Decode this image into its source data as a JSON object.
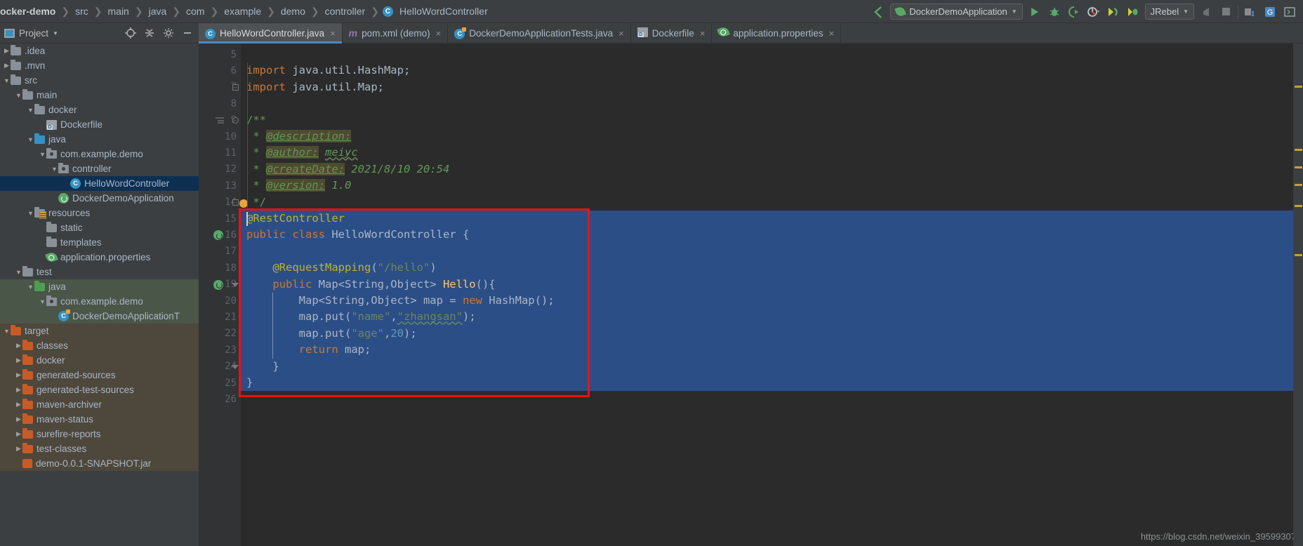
{
  "breadcrumb": {
    "items": [
      "ocker-demo",
      "src",
      "main",
      "java",
      "com",
      "example",
      "demo",
      "controller"
    ],
    "current": "HelloWordController",
    "current_icon": "C"
  },
  "toolbar": {
    "back_icon": "back-arrow-icon",
    "run_config_label": "DockerDemoApplication",
    "run_label": "run-icon",
    "debug_label": "debug-icon",
    "run_coverage_label": "run-with-coverage-icon",
    "profiler_label": "profiler-icon",
    "jrebel_run_label": "jrebel-run-icon",
    "jrebel_debug_label": "jrebel-debug-icon",
    "jrebel_label": "JRebel",
    "stop_label": "stop-icon",
    "hammer_label": "build-icon",
    "search_label": "search-everywhere-icon",
    "translate_label": "translate-icon",
    "terminal_label": "terminal-icon"
  },
  "project_panel": {
    "title": "Project",
    "locate_icon": "locate-icon",
    "collapse_icon": "collapse-all-icon",
    "settings_icon": "gear-icon",
    "hide_icon": "hide-icon"
  },
  "tree": {
    "items": [
      {
        "label": ".idea",
        "depth": 1,
        "arrow": "right",
        "icon": "folder"
      },
      {
        "label": ".mvn",
        "depth": 1,
        "arrow": "right",
        "icon": "folder"
      },
      {
        "label": "src",
        "depth": 1,
        "arrow": "down",
        "icon": "folder"
      },
      {
        "label": "main",
        "depth": 2,
        "arrow": "down",
        "icon": "folder"
      },
      {
        "label": "docker",
        "depth": 3,
        "arrow": "down",
        "icon": "folder"
      },
      {
        "label": "Dockerfile",
        "depth": 4,
        "arrow": "none",
        "icon": "docker"
      },
      {
        "label": "java",
        "depth": 3,
        "arrow": "down",
        "icon": "folder-blue"
      },
      {
        "label": "com.example.demo",
        "depth": 4,
        "arrow": "down",
        "icon": "package"
      },
      {
        "label": "controller",
        "depth": 5,
        "arrow": "down",
        "icon": "package"
      },
      {
        "label": "HelloWordController",
        "depth": 6,
        "arrow": "none",
        "icon": "class",
        "selected": true
      },
      {
        "label": "DockerDemoApplication",
        "depth": 5,
        "arrow": "none",
        "icon": "spring"
      },
      {
        "label": "resources",
        "depth": 3,
        "arrow": "down",
        "icon": "folder-res"
      },
      {
        "label": "static",
        "depth": 4,
        "arrow": "none",
        "icon": "folder"
      },
      {
        "label": "templates",
        "depth": 4,
        "arrow": "none",
        "icon": "folder"
      },
      {
        "label": "application.properties",
        "depth": 4,
        "arrow": "none",
        "icon": "properties"
      },
      {
        "label": "test",
        "depth": 2,
        "arrow": "down",
        "icon": "folder"
      },
      {
        "label": "java",
        "depth": 3,
        "arrow": "down",
        "icon": "folder-green",
        "band": "test"
      },
      {
        "label": "com.example.demo",
        "depth": 4,
        "arrow": "down",
        "icon": "package",
        "band": "test"
      },
      {
        "label": "DockerDemoApplicationT",
        "depth": 5,
        "arrow": "none",
        "icon": "test-class",
        "band": "test"
      },
      {
        "label": "target",
        "depth": 1,
        "arrow": "down",
        "icon": "folder-orange",
        "band": "target"
      },
      {
        "label": "classes",
        "depth": 2,
        "arrow": "right",
        "icon": "folder-orange",
        "band": "target"
      },
      {
        "label": "docker",
        "depth": 2,
        "arrow": "right",
        "icon": "folder-orange",
        "band": "target"
      },
      {
        "label": "generated-sources",
        "depth": 2,
        "arrow": "right",
        "icon": "folder-orange",
        "band": "target"
      },
      {
        "label": "generated-test-sources",
        "depth": 2,
        "arrow": "right",
        "icon": "folder-orange",
        "band": "target"
      },
      {
        "label": "maven-archiver",
        "depth": 2,
        "arrow": "right",
        "icon": "folder-orange",
        "band": "target"
      },
      {
        "label": "maven-status",
        "depth": 2,
        "arrow": "right",
        "icon": "folder-orange",
        "band": "target"
      },
      {
        "label": "surefire-reports",
        "depth": 2,
        "arrow": "right",
        "icon": "folder-orange",
        "band": "target"
      },
      {
        "label": "test-classes",
        "depth": 2,
        "arrow": "right",
        "icon": "folder-orange",
        "band": "target"
      },
      {
        "label": "demo-0.0.1-SNAPSHOT.jar",
        "depth": 2,
        "arrow": "none",
        "icon": "jar",
        "band": "target"
      }
    ]
  },
  "tabs": [
    {
      "label": "HelloWordController.java",
      "icon": "java-class-icon",
      "active": true,
      "close": "×"
    },
    {
      "label": "pom.xml (demo)",
      "icon": "maven-icon",
      "active": false,
      "close": "×"
    },
    {
      "label": "DockerDemoApplicationTests.java",
      "icon": "spring-test-icon",
      "active": false,
      "close": "×"
    },
    {
      "label": "Dockerfile",
      "icon": "docker-icon",
      "active": false,
      "close": "×"
    },
    {
      "label": "application.properties",
      "icon": "spring-props-icon",
      "active": false,
      "close": "×"
    }
  ],
  "editor": {
    "first_line": 5,
    "lines": [
      {
        "n": 5,
        "text": ""
      },
      {
        "n": 6,
        "text": "import java.util.HashMap;"
      },
      {
        "n": 7,
        "text": "import java.util.Map;"
      },
      {
        "n": 8,
        "text": ""
      },
      {
        "n": 9,
        "text": "/**"
      },
      {
        "n": 10,
        "text": " * @description:"
      },
      {
        "n": 11,
        "text": " * @author: meiyc"
      },
      {
        "n": 12,
        "text": " * @createDate: 2021/8/10 20:54"
      },
      {
        "n": 13,
        "text": " * @version: 1.0"
      },
      {
        "n": 14,
        "text": " */"
      },
      {
        "n": 15,
        "text": "@RestController"
      },
      {
        "n": 16,
        "text": "public class HelloWordController {"
      },
      {
        "n": 17,
        "text": ""
      },
      {
        "n": 18,
        "text": "    @RequestMapping(\"/hello\")"
      },
      {
        "n": 19,
        "text": "    public Map<String,Object> Hello(){"
      },
      {
        "n": 20,
        "text": "        Map<String,Object> map = new HashMap();"
      },
      {
        "n": 21,
        "text": "        map.put(\"name\",\"zhangsan\");"
      },
      {
        "n": 22,
        "text": "        map.put(\"age\",20);"
      },
      {
        "n": 23,
        "text": "        return map;"
      },
      {
        "n": 24,
        "text": "    }"
      },
      {
        "n": 25,
        "text": "}"
      },
      {
        "n": 26,
        "text": ""
      }
    ],
    "selection": {
      "from_line": 15,
      "to_line": 25
    },
    "javadoc": {
      "description_tag": "@description:",
      "author_tag": "@author:",
      "author_value": "meiyc",
      "createdate_tag": "@createDate:",
      "createdate_value": "2021/8/10 20:54",
      "version_tag": "@version:",
      "version_value": "1.0"
    },
    "annotation_box_color": "#f20f0f"
  },
  "watermark": "https://blog.csdn.net/weixin_39599307",
  "colors": {
    "accent": "#4a88c7",
    "selection": "#2c4e86",
    "keyword": "#cc7832",
    "string": "#6a8759",
    "number": "#6897bb",
    "annotation": "#bbb529",
    "comment": "#629755",
    "method": "#ffc66d"
  }
}
